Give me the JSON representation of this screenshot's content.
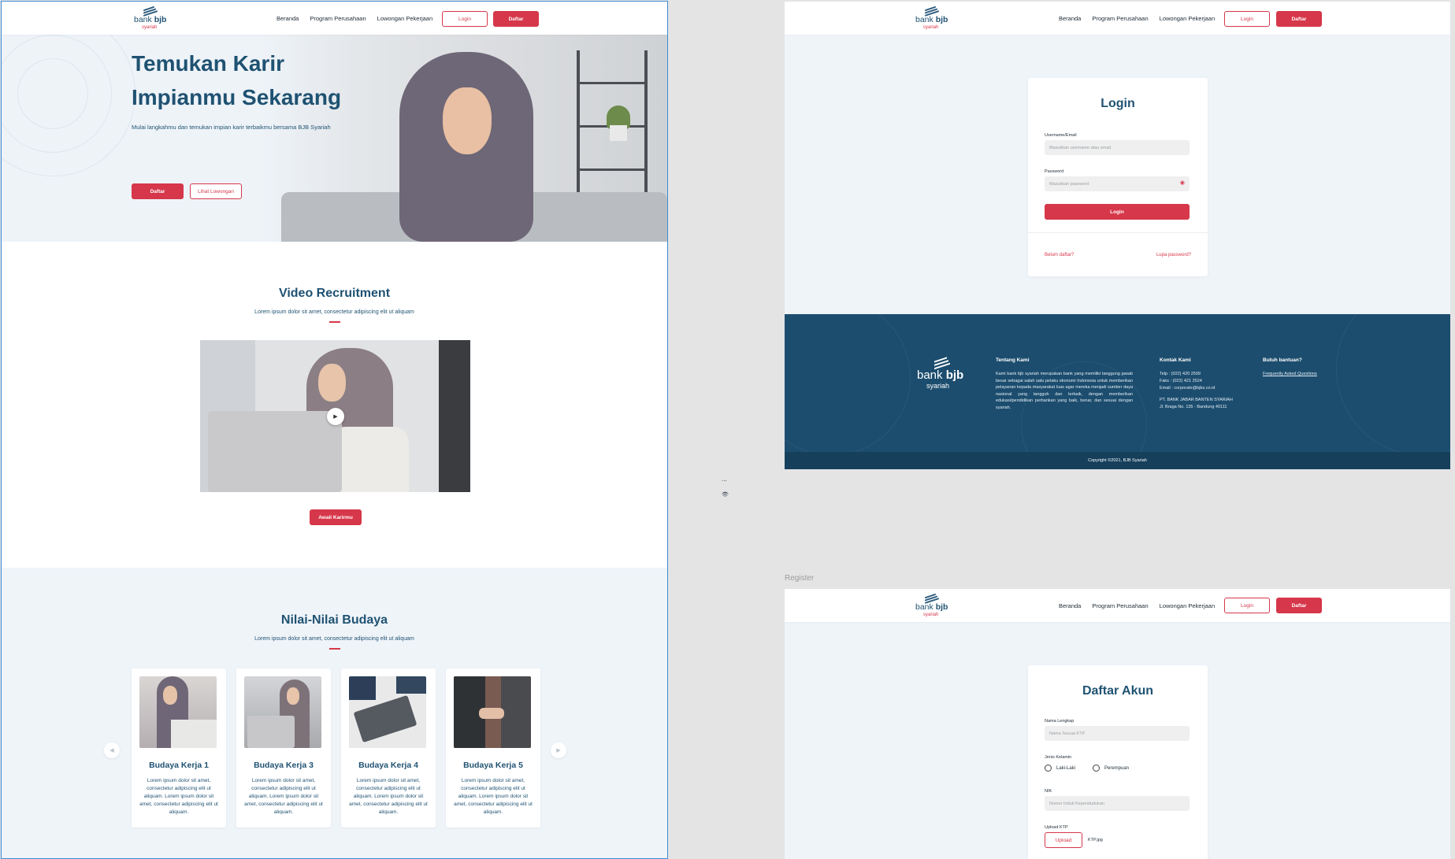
{
  "nav": {
    "logo_bank": "bank",
    "logo_bjb": "bjb",
    "logo_sub": "syariah",
    "items": [
      "Beranda",
      "Program Perusahaan",
      "Lowongan Pekerjaan"
    ],
    "login": "Login",
    "register": "Daftar"
  },
  "hero": {
    "title_line1": "Temukan Karir",
    "title_line2": "Impianmu Sekarang",
    "subtitle": "Mulai langkahmu dan temukan impian karir terbaikmu bersama BJB Syariah",
    "primary_button": "Daftar",
    "secondary_button": "Lihat Lowongan"
  },
  "video_section": {
    "title": "Video Recruitment",
    "subtitle": "Lorem ipsum dolor sit amet, consectetur adipiscing elit ut aliquam",
    "cta": "Awali Karirmu",
    "play_icon": "play-icon"
  },
  "culture": {
    "title": "Nilai-Nilai Budaya",
    "subtitle": "Lorem ipsum dolor sit amet, consectetur adipiscing elit ut aliquam",
    "prev_icon": "chevron-left-icon",
    "next_icon": "chevron-right-icon",
    "cards": [
      {
        "title": "Budaya Kerja 1",
        "text": "Lorem ipsum dolor sit amet, consectetur adipiscing elit ut aliquam. Lorem ipsum dolor sit amet, consectetur adipiscing elit ut aliquam."
      },
      {
        "title": "Budaya Kerja 3",
        "text": "Lorem ipsum dolor sit amet, consectetur adipiscing elit ut aliquam. Lorem ipsum dolor sit amet, consectetur adipiscing elit ut aliquam."
      },
      {
        "title": "Budaya Kerja 4",
        "text": "Lorem ipsum dolor sit amet, consectetur adipiscing elit ut aliquam. Lorem ipsum dolor sit amet, consectetur adipiscing elit ut aliquam."
      },
      {
        "title": "Budaya Kerja 5",
        "text": "Lorem ipsum dolor sit amet, consectetur adipiscing elit ut aliquam. Lorem ipsum dolor sit amet, consectetur adipiscing elit ut aliquam."
      }
    ]
  },
  "login": {
    "title": "Login",
    "username_label": "Username/Email",
    "username_placeholder": "Masukkan username atau email",
    "password_label": "Password",
    "password_placeholder": "Masukkan password",
    "submit": "Login",
    "not_registered": "Belum daftar?",
    "forgot": "Lupa password?"
  },
  "footer": {
    "about_title": "Tentang Kami",
    "about_text": "Kami bank bjb syariah merupakan bank yang memiliki tanggung jawab besar sebagai salah satu pelaku ekonomi Indonesia untuk memberikan pelayanan kepada masyarakat luas agar mereka menjadi sumber daya nasional yang tangguh dan terbaik, dengan memberikan edukasi/pendidikan perbankan yang baik, benar, dan sesuai dengan syariah.",
    "contact_title": "Kontak Kami",
    "contact_phone": "Telp : (022) 420 2599",
    "contact_fax": "Faks : (022) 421 2524",
    "contact_email": "Email : corporate@bjbs.co.id",
    "company": "PT. BANK JABAR BANTEN SYARIAH",
    "address": "Jl. Braga No. 135 - Bandung 40111",
    "help_title": "Butuh bantuan?",
    "faq": "Frequently Asked Questions",
    "copyright": "Copyright ©2021, BJB Syariah"
  },
  "register": {
    "caption": "Register",
    "title": "Daftar Akun",
    "name_label": "Nama Lengkap",
    "name_placeholder": "Nama Sesuai KTP",
    "gender_label": "Jenis Kelamin",
    "gender_male": "Laki-Laki",
    "gender_female": "Perempuan",
    "nik_label": "NIK",
    "nik_placeholder": "Nomor Induk Kependudukan",
    "ktp_label": "Upload KTP",
    "upload_button": "Upload",
    "ktp_file": "KTP.jpg"
  },
  "stray": {
    "dots": "..."
  },
  "colors": {
    "primary": "#1f5272",
    "accent": "#d6374a",
    "footer": "#1c4d6e",
    "light_bg": "#eff4f9"
  }
}
